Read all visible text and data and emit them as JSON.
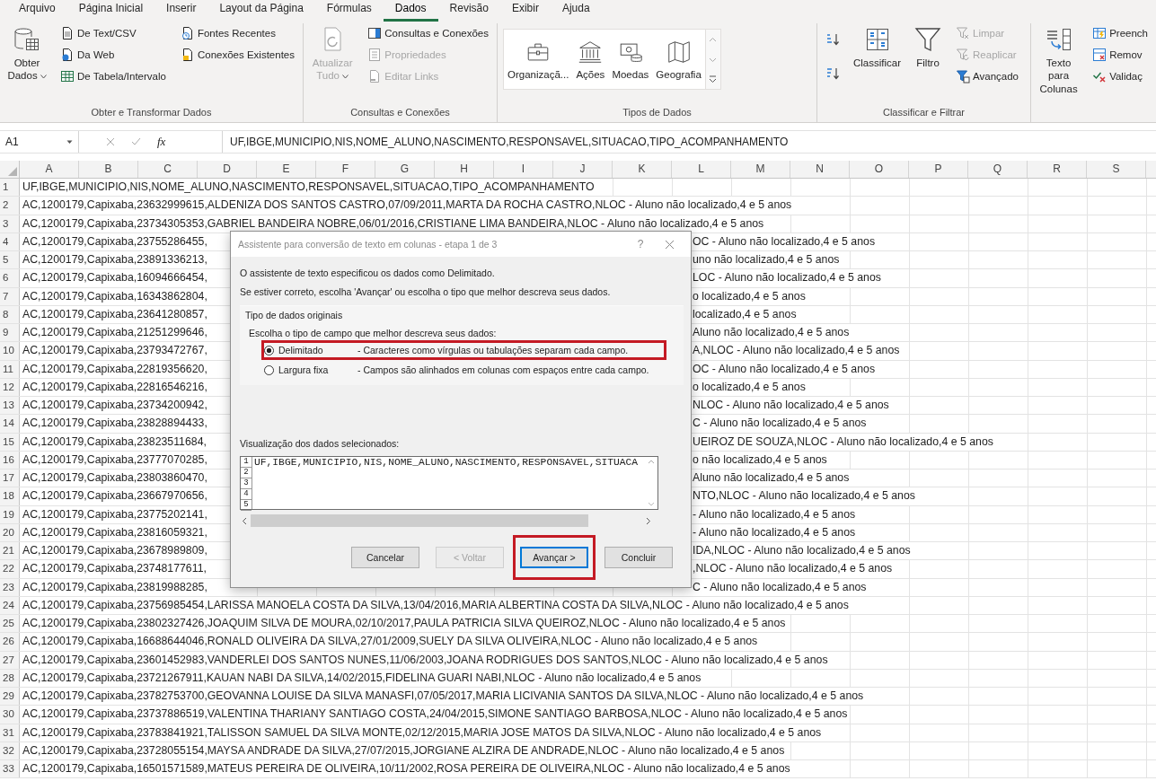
{
  "menu_tabs": [
    {
      "label": "Arquivo",
      "selected": false
    },
    {
      "label": "Página Inicial",
      "selected": false
    },
    {
      "label": "Inserir",
      "selected": false
    },
    {
      "label": "Layout da Página",
      "selected": false
    },
    {
      "label": "Fórmulas",
      "selected": false
    },
    {
      "label": "Dados",
      "selected": true
    },
    {
      "label": "Revisão",
      "selected": false
    },
    {
      "label": "Exibir",
      "selected": false
    },
    {
      "label": "Ajuda",
      "selected": false
    }
  ],
  "ribbon_groups": [
    {
      "kind": "buttons",
      "label": "Obter e Transformar Dados",
      "columns": [
        [
          {
            "kind": "large",
            "label": "Obter Dados",
            "dropdown": true,
            "disabled": false
          }
        ],
        [
          {
            "kind": "small",
            "label": "De Text/CSV",
            "disabled": false
          },
          {
            "kind": "small",
            "label": "Da Web",
            "disabled": false
          },
          {
            "kind": "small",
            "label": "De Tabela/Intervalo",
            "disabled": false
          }
        ],
        [
          {
            "kind": "small",
            "label": "Fontes Recentes",
            "disabled": false
          },
          {
            "kind": "small",
            "label": "Conexões Existentes",
            "disabled": false
          }
        ]
      ]
    },
    {
      "kind": "buttons",
      "label": "Consultas e Conexões",
      "columns": [
        [
          {
            "kind": "large",
            "label": "Atualizar Tudo",
            "dropdown": true,
            "disabled": true
          }
        ],
        [
          {
            "kind": "small",
            "label": "Consultas e Conexões",
            "disabled": false
          },
          {
            "kind": "small",
            "label": "Propriedades",
            "disabled": true
          },
          {
            "kind": "small",
            "label": "Editar Links",
            "disabled": true
          }
        ]
      ]
    },
    {
      "kind": "gallery",
      "label": "Tipos de Dados",
      "items": [
        {
          "label": "Organizaçã..."
        },
        {
          "label": "Ações"
        },
        {
          "label": "Moedas"
        },
        {
          "label": "Geografia"
        }
      ]
    },
    {
      "kind": "buttons",
      "label": "Classificar e Filtrar",
      "columns": [
        [
          {
            "kind": "icon"
          },
          {
            "kind": "icon"
          }
        ],
        [
          {
            "kind": "large",
            "label": "Classificar",
            "disabled": false
          }
        ],
        [
          {
            "kind": "large",
            "label": "Filtro",
            "disabled": false
          }
        ],
        [
          {
            "kind": "small",
            "label": "Limpar",
            "disabled": true
          },
          {
            "kind": "small",
            "label": "Reaplicar",
            "disabled": true
          },
          {
            "kind": "small",
            "label": "Avançado",
            "disabled": false
          }
        ]
      ]
    },
    {
      "kind": "buttons",
      "columns": [
        [
          {
            "kind": "large",
            "label": "Texto para Colunas",
            "disabled": false
          }
        ],
        [
          {
            "kind": "small",
            "label": "Preench",
            "disabled": false
          },
          {
            "kind": "small",
            "label": "Remov",
            "disabled": false
          },
          {
            "kind": "small",
            "label": "Validaç",
            "disabled": false
          }
        ]
      ]
    }
  ],
  "formula_bar": {
    "name_box": "A1",
    "function_label": "fx",
    "formula": "UF,IBGE,MUNICIPIO,NIS,NOME_ALUNO,NASCIMENTO,RESPONSAVEL,SITUACAO,TIPO_ACOMPANHAMENTO"
  },
  "columns": [
    "A",
    "B",
    "C",
    "D",
    "E",
    "F",
    "G",
    "H",
    "I",
    "J",
    "K",
    "L",
    "M",
    "N",
    "O",
    "P",
    "Q",
    "R",
    "S"
  ],
  "rows": [
    {
      "kind": "full",
      "number": "1",
      "text": "UF,IBGE,MUNICIPIO,NIS,NOME_ALUNO,NASCIMENTO,RESPONSAVEL,SITUACAO,TIPO_ACOMPANHAMENTO"
    },
    {
      "kind": "full",
      "number": "2",
      "text": "AC,1200179,Capixaba,23632999615,ALDENIZA DOS SANTOS CASTRO,07/09/2011,MARTA DA ROCHA CASTRO,NLOC - Aluno não localizado,4 e 5 anos"
    },
    {
      "kind": "full",
      "number": "3",
      "text": "AC,1200179,Capixaba,23734305353,GABRIEL BANDEIRA NOBRE,06/01/2016,CRISTIANE LIMA BANDEIRA,NLOC - Aluno não localizado,4 e 5 anos"
    },
    {
      "kind": "split",
      "number": "4",
      "left": "AC,1200179,Capixaba,23755286455,",
      "right": "OC - Aluno não localizado,4 e 5 anos"
    },
    {
      "kind": "split",
      "number": "5",
      "left": "AC,1200179,Capixaba,23891336213,",
      "right": "uno não localizado,4 e 5 anos"
    },
    {
      "kind": "split",
      "number": "6",
      "left": "AC,1200179,Capixaba,16094666454,",
      "right": "LOC - Aluno não localizado,4 e 5 anos"
    },
    {
      "kind": "split",
      "number": "7",
      "left": "AC,1200179,Capixaba,16343862804,",
      "right": "o localizado,4 e 5 anos"
    },
    {
      "kind": "split",
      "number": "8",
      "left": "AC,1200179,Capixaba,23641280857,",
      "right": "localizado,4 e 5 anos"
    },
    {
      "kind": "split",
      "number": "9",
      "left": "AC,1200179,Capixaba,21251299646,",
      "right": "Aluno não localizado,4 e 5 anos"
    },
    {
      "kind": "split",
      "number": "10",
      "left": "AC,1200179,Capixaba,23793472767,",
      "right": "A,NLOC - Aluno não localizado,4 e 5 anos"
    },
    {
      "kind": "split",
      "number": "11",
      "left": "AC,1200179,Capixaba,22819356620,",
      "right": "OC - Aluno não localizado,4 e 5 anos"
    },
    {
      "kind": "split",
      "number": "12",
      "left": "AC,1200179,Capixaba,22816546216,",
      "right": "o localizado,4 e 5 anos"
    },
    {
      "kind": "split",
      "number": "13",
      "left": "AC,1200179,Capixaba,23734200942,",
      "right": "NLOC - Aluno não localizado,4 e 5 anos"
    },
    {
      "kind": "split",
      "number": "14",
      "left": "AC,1200179,Capixaba,23828894433,",
      "right": "C - Aluno não localizado,4 e 5 anos"
    },
    {
      "kind": "split",
      "number": "15",
      "left": "AC,1200179,Capixaba,23823511684,",
      "right": "UEIROZ DE SOUZA,NLOC - Aluno não localizado,4 e 5 anos"
    },
    {
      "kind": "split",
      "number": "16",
      "left": "AC,1200179,Capixaba,23777070285,",
      "right": "o não localizado,4 e 5 anos"
    },
    {
      "kind": "split",
      "number": "17",
      "left": "AC,1200179,Capixaba,23803860470,",
      "right": "Aluno não localizado,4 e 5 anos"
    },
    {
      "kind": "split",
      "number": "18",
      "left": "AC,1200179,Capixaba,23667970656,",
      "right": "NTO,NLOC - Aluno não localizado,4 e 5 anos"
    },
    {
      "kind": "split",
      "number": "19",
      "left": "AC,1200179,Capixaba,23775202141,",
      "right": "- Aluno não localizado,4 e 5 anos"
    },
    {
      "kind": "split",
      "number": "20",
      "left": "AC,1200179,Capixaba,23816059321,",
      "right": "- Aluno não localizado,4 e 5 anos"
    },
    {
      "kind": "split",
      "number": "21",
      "left": "AC,1200179,Capixaba,23678989809,",
      "right": "IDA,NLOC - Aluno não localizado,4 e 5 anos"
    },
    {
      "kind": "split",
      "number": "22",
      "left": "AC,1200179,Capixaba,23748177611,",
      "right": ",NLOC - Aluno não localizado,4 e 5 anos"
    },
    {
      "kind": "split",
      "number": "23",
      "left": "AC,1200179,Capixaba,23819988285,",
      "right": "C - Aluno não localizado,4 e 5 anos"
    },
    {
      "kind": "full",
      "number": "24",
      "text": "AC,1200179,Capixaba,23756985454,LARISSA MANOELA COSTA DA SILVA,13/04/2016,MARIA ALBERTINA COSTA DA SILVA,NLOC - Aluno não localizado,4 e 5 anos"
    },
    {
      "kind": "full",
      "number": "25",
      "text": "AC,1200179,Capixaba,23802327426,JOAQUIM SILVA DE MOURA,02/10/2017,PAULA PATRICIA SILVA QUEIROZ,NLOC - Aluno não localizado,4 e 5 anos"
    },
    {
      "kind": "full",
      "number": "26",
      "text": "AC,1200179,Capixaba,16688644046,RONALD OLIVEIRA DA SILVA,27/01/2009,SUELY DA SILVA OLIVEIRA,NLOC - Aluno não localizado,4 e 5 anos"
    },
    {
      "kind": "full",
      "number": "27",
      "text": "AC,1200179,Capixaba,23601452983,VANDERLEI DOS SANTOS NUNES,11/06/2003,JOANA RODRIGUES DOS SANTOS,NLOC - Aluno não localizado,4 e 5 anos"
    },
    {
      "kind": "full",
      "number": "28",
      "text": "AC,1200179,Capixaba,23721267911,KAUAN NABI DA SILVA,14/02/2015,FIDELINA GUARI NABI,NLOC - Aluno não localizado,4 e 5 anos"
    },
    {
      "kind": "full",
      "number": "29",
      "text": "AC,1200179,Capixaba,23782753700,GEOVANNA LOUISE DA SILVA MANASFI,07/05/2017,MARIA LICIVANIA SANTOS DA SILVA,NLOC - Aluno não localizado,4 e 5 anos"
    },
    {
      "kind": "full",
      "number": "30",
      "text": "AC,1200179,Capixaba,23737886519,VALENTINA THARIANY SANTIAGO COSTA,24/04/2015,SIMONE SANTIAGO BARBOSA,NLOC - Aluno não localizado,4 e 5 anos"
    },
    {
      "kind": "full",
      "number": "31",
      "text": "AC,1200179,Capixaba,23783841921,TALISSON SAMUEL DA SILVA MONTE,02/12/2015,MARIA JOSE MATOS DA SILVA,NLOC - Aluno não localizado,4 e 5 anos"
    },
    {
      "kind": "full",
      "number": "32",
      "text": "AC,1200179,Capixaba,23728055154,MAYSA ANDRADE DA SILVA,27/07/2015,JORGIANE ALZIRA DE ANDRADE,NLOC - Aluno não localizado,4 e 5 anos"
    },
    {
      "kind": "full",
      "number": "33",
      "text": "AC,1200179,Capixaba,16501571589,MATEUS PEREIRA DE OLIVEIRA,10/11/2002,ROSA PEREIRA DE OLIVEIRA,NLOC - Aluno não localizado,4 e 5 anos"
    }
  ],
  "dialog": {
    "title": "Assistente para conversão de texto em colunas - etapa 1 de 3",
    "help": "?",
    "intro": "O assistente de texto especificou os dados como Delimitado.",
    "instruction": "Se estiver correto, escolha 'Avançar' ou escolha o tipo que melhor descreva seus dados.",
    "group_label": "Tipo de dados originais",
    "prompt": "Escolha o tipo de campo que melhor descreva seus dados:",
    "options": [
      {
        "label": "Delimitado",
        "description": "- Caracteres como vírgulas ou tabulações separam cada campo.",
        "selected": true,
        "highlighted": true
      },
      {
        "label": "Largura fixa",
        "description": "- Campos são alinhados em colunas com espaços entre cada campo.",
        "selected": false,
        "highlighted": false
      }
    ],
    "preview_label": "Visualização dos dados selecionados:",
    "preview_lines": [
      {
        "number": "1",
        "text": "UF,IBGE,MUNICIPIO,NIS,NOME_ALUNO,NASCIMENTO,RESPONSAVEL,SITUACA"
      },
      {
        "number": "2"
      },
      {
        "number": "3"
      },
      {
        "number": "4"
      },
      {
        "number": "5"
      }
    ],
    "buttons": [
      {
        "label": "Cancelar",
        "disabled": false,
        "default": false,
        "highlighted": false
      },
      {
        "label": "< Voltar",
        "disabled": true,
        "default": false,
        "highlighted": false
      },
      {
        "label": "Avançar >",
        "disabled": false,
        "default": true,
        "highlighted": true
      },
      {
        "label": "Concluir",
        "disabled": false,
        "default": false,
        "highlighted": false
      }
    ]
  }
}
